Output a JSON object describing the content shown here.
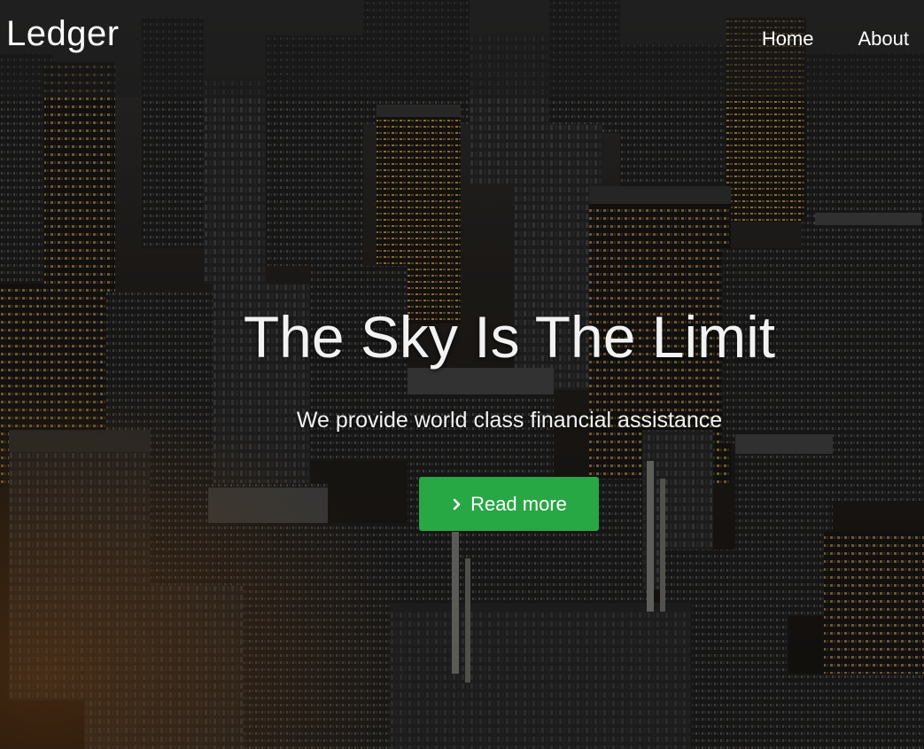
{
  "navbar": {
    "brand": "Ledger",
    "links": [
      {
        "label": "Home"
      },
      {
        "label": "About"
      }
    ]
  },
  "hero": {
    "title": "The Sky Is The Limit",
    "subtitle": "We provide world class financial assistance",
    "cta": {
      "label": "Read more",
      "icon": "chevron-right-icon",
      "color": "#28a745"
    },
    "background": "night-city-skyline-image"
  },
  "colors": {
    "text": "#ffffff",
    "navbar_overlay": "rgba(28,28,28,0.55)",
    "button": "#28a745"
  }
}
